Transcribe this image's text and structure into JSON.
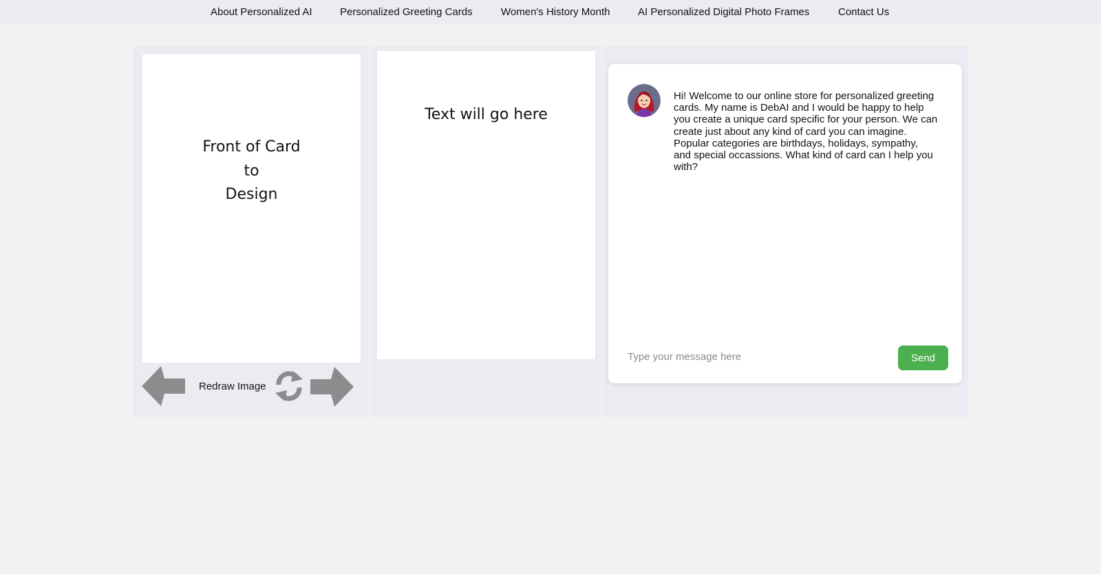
{
  "nav": {
    "items": [
      {
        "label": "About Personalized AI"
      },
      {
        "label": "Personalized Greeting Cards"
      },
      {
        "label": "Women's History Month"
      },
      {
        "label": "AI Personalized Digital Photo Frames"
      },
      {
        "label": "Contact Us"
      }
    ]
  },
  "card": {
    "front_lines": [
      "Front of Card",
      "to",
      "Design"
    ],
    "inside_text": "Text will go here",
    "redraw_label": "Redraw Image",
    "icons": {
      "prev": "arrow-left-icon",
      "redraw": "refresh-icon",
      "next": "arrow-right-icon"
    }
  },
  "chat": {
    "avatar_icon": "avatar-icon",
    "welcome_message": "Hi! Welcome to our online store for personalized greeting cards. My name is DebAI and I would be happy to help you create a unique card specific for your person. We can create just about any kind of card you can imagine. Popular categories are birthdays, holidays, sympathy, and special occassions. What kind of card can I help you with?",
    "input_placeholder": "Type your message here",
    "send_label": "Send"
  },
  "colors": {
    "nav_bg": "#ecebf1",
    "page_bg": "#f2f2f2",
    "panel_bg": "#ecebf2",
    "send_button": "#4caf50",
    "control_icon": "#8c8c8c"
  }
}
